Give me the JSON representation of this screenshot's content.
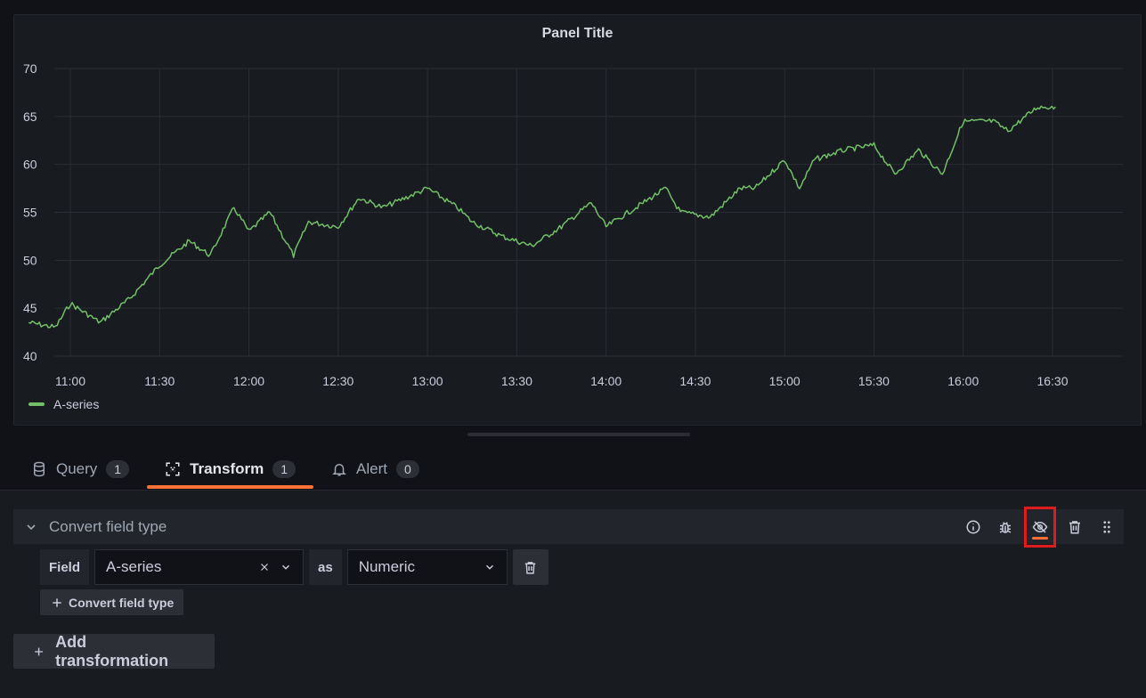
{
  "panel": {
    "title": "Panel Title"
  },
  "chart_data": {
    "type": "line",
    "title": "Panel Title",
    "xlabel": "",
    "ylabel": "",
    "ylim": [
      40,
      70
    ],
    "yticks": [
      "40",
      "45",
      "50",
      "55",
      "60",
      "65",
      "70"
    ],
    "xticks": [
      "11:00",
      "11:30",
      "12:00",
      "12:30",
      "13:00",
      "13:30",
      "14:00",
      "14:30",
      "15:00",
      "15:30",
      "16:00",
      "16:30"
    ],
    "x": [
      "10:46",
      "10:55",
      "11:00",
      "11:10",
      "11:20",
      "11:30",
      "11:40",
      "11:47",
      "11:55",
      "12:00",
      "12:07",
      "12:15",
      "12:20",
      "12:30",
      "12:37",
      "12:45",
      "13:00",
      "13:10",
      "13:15",
      "13:25",
      "13:35",
      "13:45",
      "13:55",
      "14:00",
      "14:10",
      "14:20",
      "14:25",
      "14:35",
      "14:45",
      "14:50",
      "15:00",
      "15:05",
      "15:10",
      "15:20",
      "15:30",
      "15:37",
      "15:45",
      "15:53",
      "16:00",
      "16:10",
      "16:15",
      "16:25",
      "16:31"
    ],
    "series": [
      {
        "name": "A-series",
        "color": "#73bf69",
        "values": [
          43.5,
          43,
          45.5,
          43.5,
          46,
          49.5,
          52,
          50.5,
          55.5,
          53,
          55,
          50.5,
          54,
          53.5,
          56.5,
          55.5,
          57.5,
          55.5,
          54,
          52.5,
          51.5,
          53.5,
          56,
          53.5,
          55.5,
          57.5,
          55,
          54.5,
          57.5,
          57.5,
          60.5,
          57.5,
          60.5,
          61.5,
          62,
          59,
          61.5,
          59,
          64.5,
          64.5,
          63.5,
          66,
          66
        ]
      }
    ],
    "grid": true,
    "legend": "bottom-left"
  },
  "tabs": [
    {
      "label": "Query",
      "count": "1",
      "icon": "database-icon"
    },
    {
      "label": "Transform",
      "count": "1",
      "icon": "transform-icon"
    },
    {
      "label": "Alert",
      "count": "0",
      "icon": "bell-icon"
    }
  ],
  "transformation": {
    "title": "Convert field type",
    "actions": [
      "info-icon",
      "debug-icon",
      "eye-slash-icon",
      "trash-icon",
      "drag-handle-icon"
    ],
    "field_label": "Field",
    "field_value": "A-series",
    "as_label": "as",
    "type_value": "Numeric",
    "add_field_button": "Convert field type"
  },
  "add_transformation_button": "Add transformation"
}
